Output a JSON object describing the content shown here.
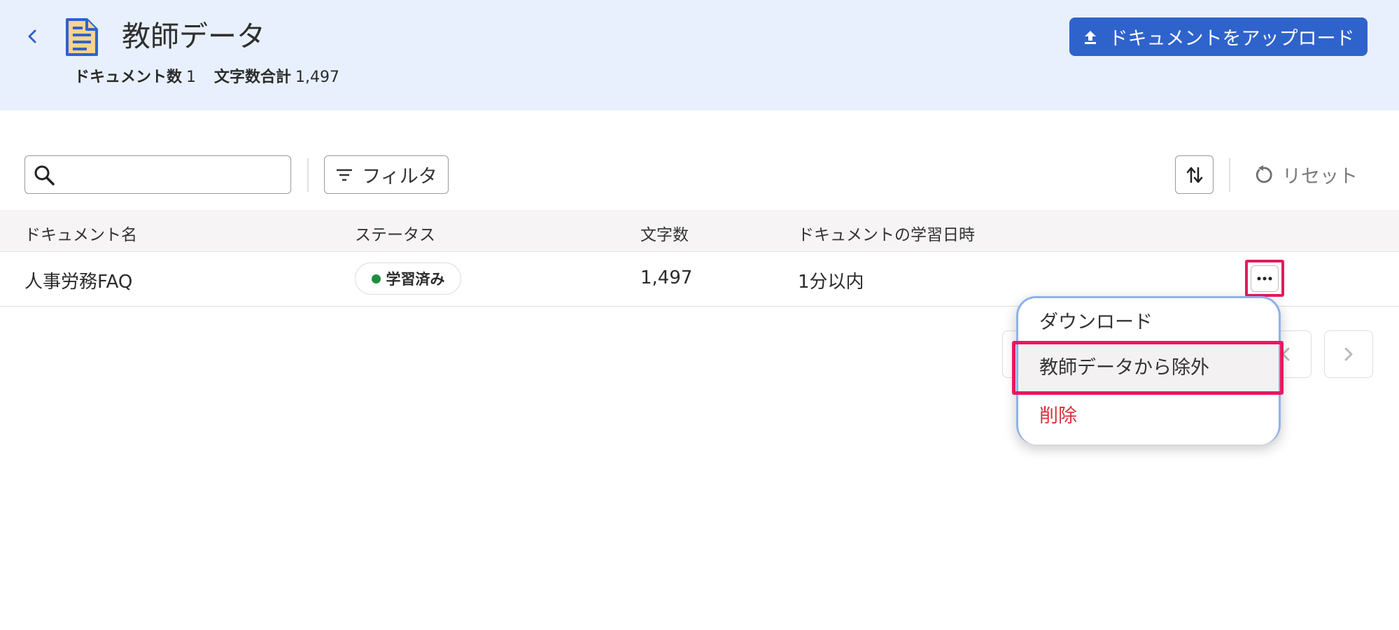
{
  "header": {
    "title": "教師データ",
    "doc_count_label": "ドキュメント数",
    "doc_count_value": "1",
    "char_total_label": "文字数合計",
    "char_total_value": "1,497",
    "upload_label": "ドキュメントをアップロード"
  },
  "toolbar": {
    "search_placeholder": "",
    "search_value": "",
    "filter_label": "フィルタ",
    "reset_label": "リセット"
  },
  "table": {
    "columns": [
      "ドキュメント名",
      "ステータス",
      "文字数",
      "ドキュメントの学習日時"
    ],
    "rows": [
      {
        "name": "人事労務FAQ",
        "status": "学習済み",
        "chars": "1,497",
        "learned_at": "1分以内"
      }
    ]
  },
  "menu": {
    "items": [
      "ダウンロード",
      "教師データから除外",
      "削除"
    ]
  },
  "colors": {
    "header_bg": "#e8f0fd",
    "primary": "#2f63cc",
    "highlight": "#e8185f",
    "danger": "#d6323a",
    "status_green": "#1e8e3e"
  }
}
